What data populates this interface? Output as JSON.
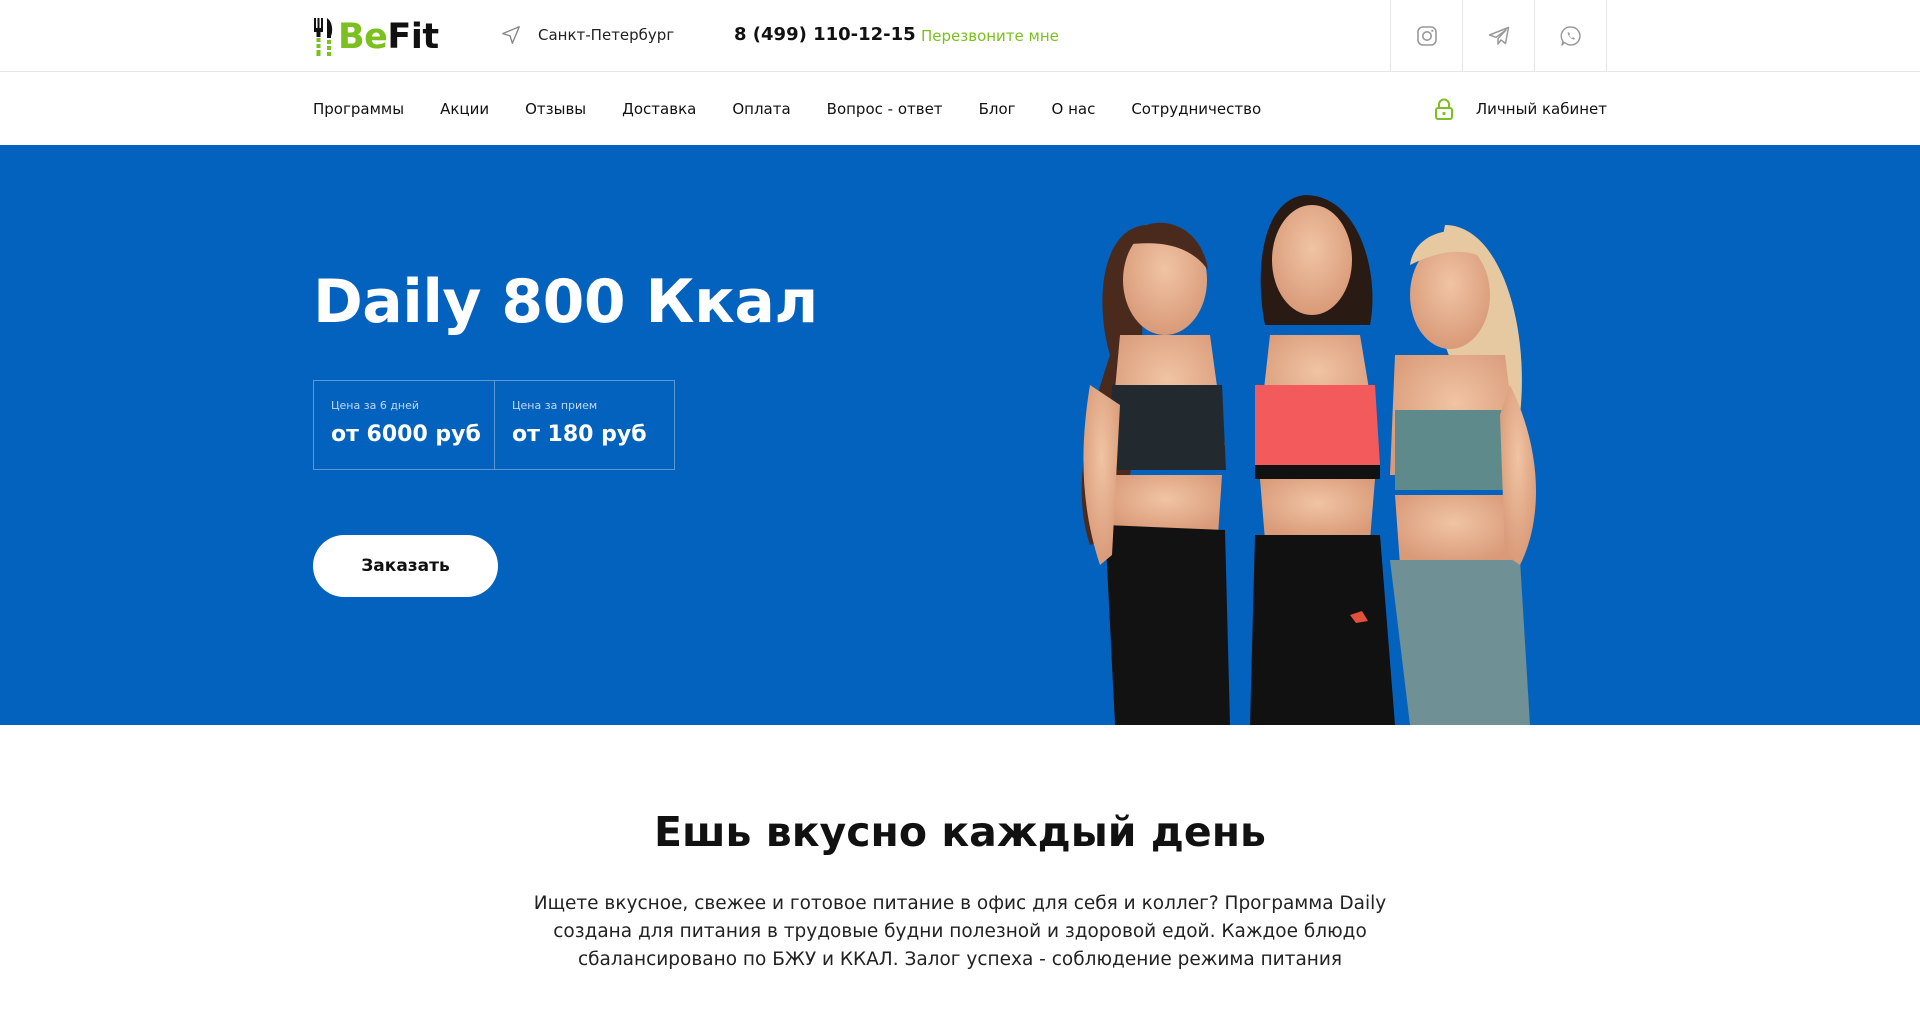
{
  "header": {
    "logo": {
      "part1": "Be",
      "part2": "Fit"
    },
    "city": "Санкт-Петербург",
    "phone": "8 (499) 110-12-15",
    "callback_label": "Перезвоните мне",
    "socials": [
      {
        "icon": "instagram-icon"
      },
      {
        "icon": "telegram-icon"
      },
      {
        "icon": "whatsapp-icon"
      }
    ]
  },
  "nav": {
    "items": [
      {
        "label": "Программы"
      },
      {
        "label": "Акции"
      },
      {
        "label": "Отзывы"
      },
      {
        "label": "Доставка"
      },
      {
        "label": "Оплата"
      },
      {
        "label": "Вопрос - ответ"
      },
      {
        "label": "Блог"
      },
      {
        "label": "О нас"
      },
      {
        "label": "Сотрудничество"
      }
    ],
    "cabinet_label": "Личный кабинет"
  },
  "hero": {
    "title": "Daily 800 Ккал",
    "prices": [
      {
        "caption": "Цена за 6 дней",
        "value": "от 6000 руб"
      },
      {
        "caption": "Цена за прием",
        "value": "от 180 руб"
      }
    ],
    "order_label": "Заказать"
  },
  "intro": {
    "title": "Ешь вкусно каждый день",
    "text": "Ищете вкусное, свежее и готовое питание в офис для себя и коллег? Программа Daily создана для питания в трудовые будни полезной и здоровой едой. Каждое блюдо сбалансировано по БЖУ и ККАЛ. Залог успеха - соблюдение режима питания"
  },
  "colors": {
    "brand_green": "#7cc01f",
    "hero_blue": "#0362be",
    "text_dark": "#111111"
  }
}
